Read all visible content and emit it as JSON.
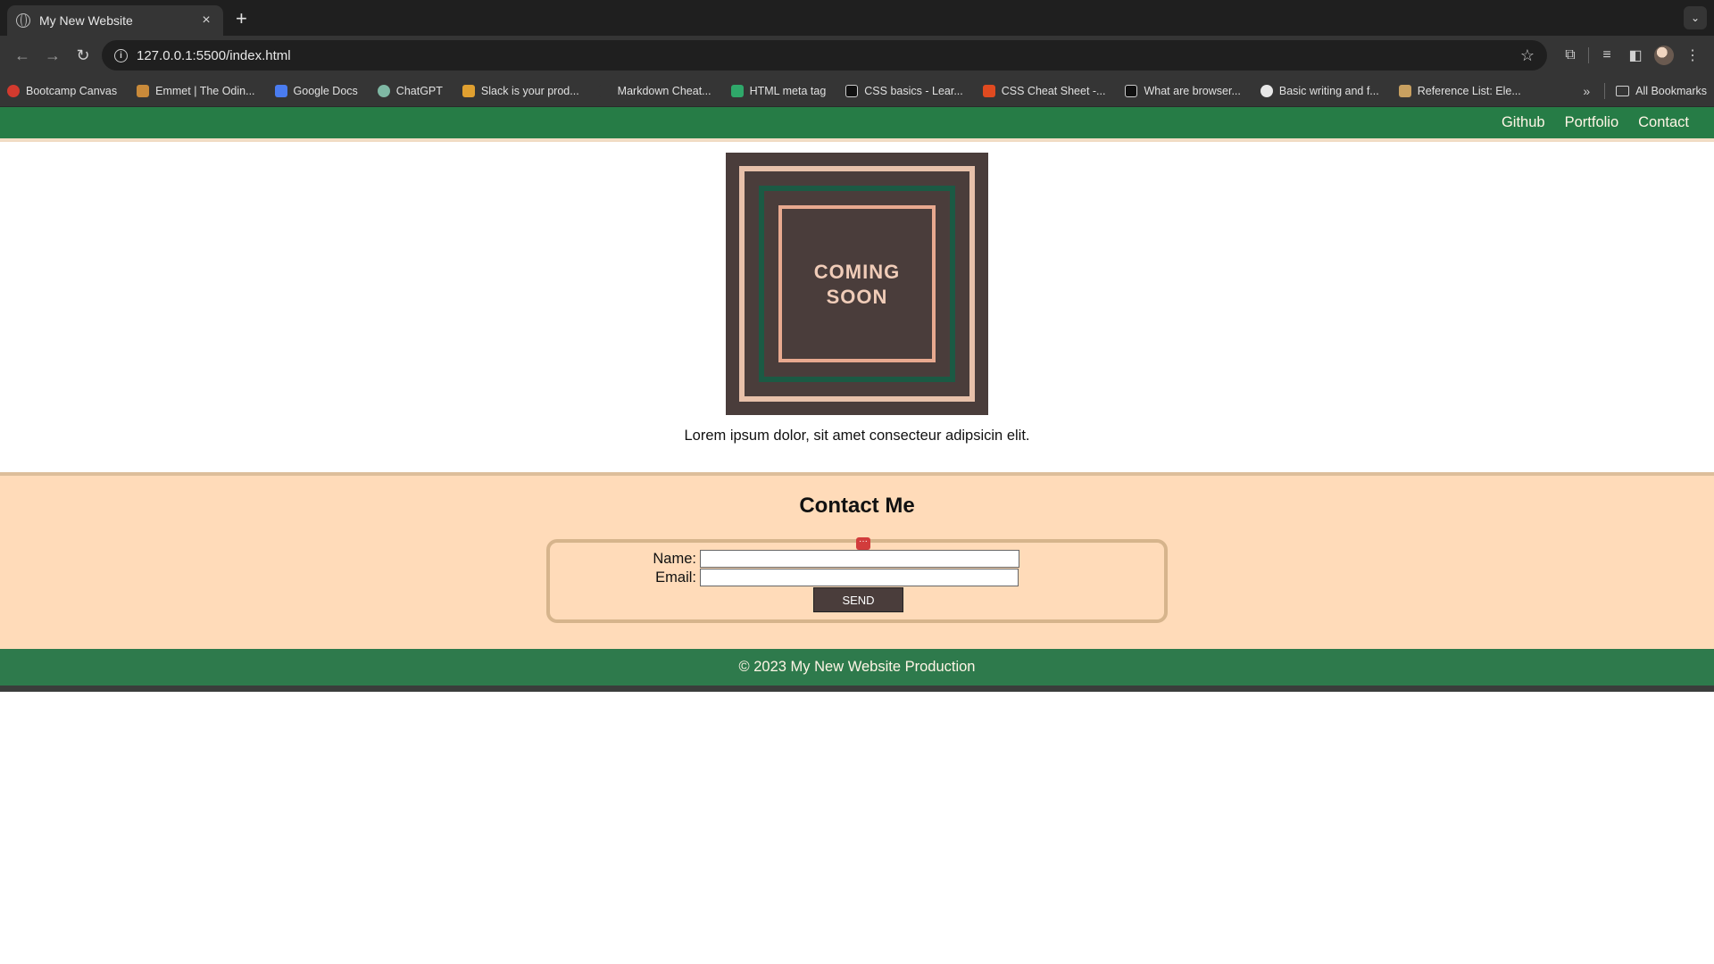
{
  "browser": {
    "tab_title": "My New Website",
    "tab_close": "×",
    "new_tab": "+",
    "url": "127.0.0.1:5500/index.html",
    "bookmarks": [
      {
        "label": "Bootcamp Canvas",
        "color": "#d23a2e"
      },
      {
        "label": "Emmet | The Odin...",
        "color": "#c98a3a"
      },
      {
        "label": "Google Docs",
        "color": "#4a7cf0"
      },
      {
        "label": "ChatGPT",
        "color": "#7fb8a4"
      },
      {
        "label": "Slack is your prod...",
        "color": "#e0a030"
      },
      {
        "label": "Markdown Cheat...",
        "color": "#353535"
      },
      {
        "label": "HTML meta tag",
        "color": "#2fa86a"
      },
      {
        "label": "CSS basics - Lear...",
        "color": "#111111"
      },
      {
        "label": "CSS Cheat Sheet -...",
        "color": "#e04a20"
      },
      {
        "label": "What are browser...",
        "color": "#111111"
      },
      {
        "label": "Basic writing and f...",
        "color": "#e8e8e8"
      },
      {
        "label": "Reference List: Ele...",
        "color": "#c8a060"
      }
    ],
    "more_bookmarks": "»",
    "all_bookmarks": "All Bookmarks"
  },
  "site": {
    "nav": [
      "Github",
      "Portfolio",
      "Contact"
    ],
    "hero_image_text": [
      "COMING",
      "SOON"
    ],
    "hero_text": "Lorem ipsum dolor, sit amet consecteur adipsicin elit.",
    "contact": {
      "heading": "Contact Me",
      "name_label": "Name:",
      "email_label": "Email:",
      "send_label": "SEND",
      "badge": "···"
    },
    "footer": "© 2023 My New Website Production"
  },
  "colors": {
    "nav_green": "#267c46",
    "contact_bg": "#ffdbb9",
    "image_bg": "#4a3d3b"
  }
}
